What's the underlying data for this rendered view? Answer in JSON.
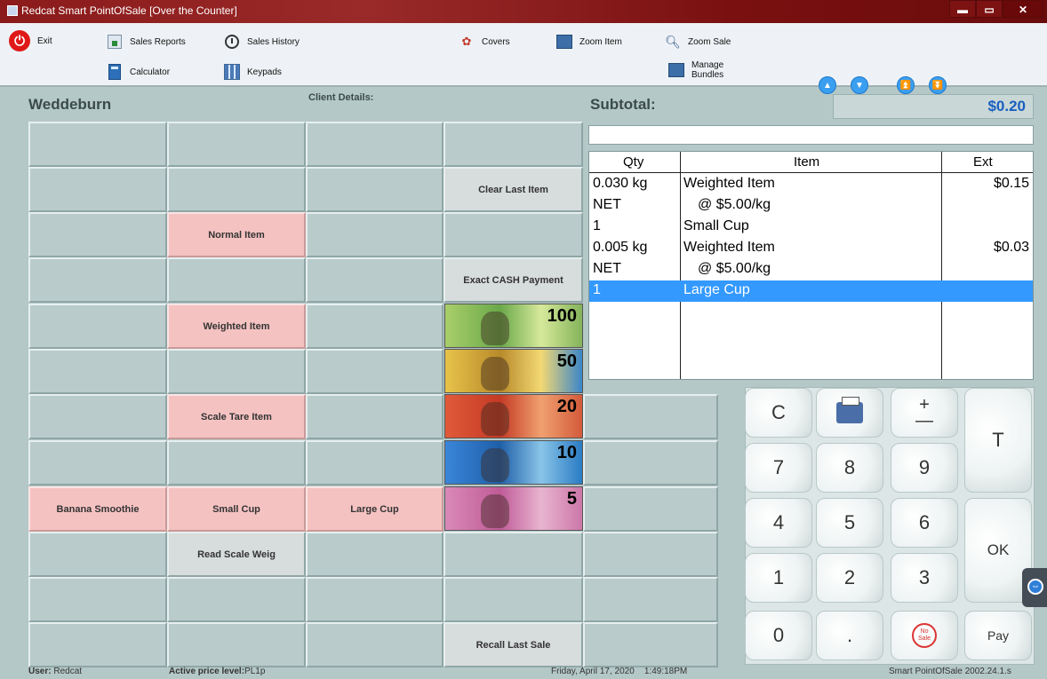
{
  "window": {
    "title": "Redcat Smart PointOfSale [Over the Counter]",
    "min": "▬",
    "max": "▭",
    "close": "✕"
  },
  "toolbar": {
    "exit": "Exit",
    "sales_reports": "Sales Reports",
    "sales_history": "Sales History",
    "covers": "Covers",
    "zoom_item": "Zoom Item",
    "zoom_sale": "Zoom Sale",
    "calculator": "Calculator",
    "keypads": "Keypads",
    "manage_bundles": "Manage Bundles",
    "nav": [
      "▲",
      "▼",
      "⏫",
      "⏬"
    ]
  },
  "header": {
    "store_name": "Weddeburn",
    "client_details": "Client Details:",
    "subtotal_label": "Subtotal:",
    "subtotal_value": "$0.20"
  },
  "grid_buttons": {
    "clear_last_item": "Clear Last Item",
    "normal_item": "Normal Item",
    "exact_cash_payment": "Exact CASH Payment",
    "weighted_item": "Weighted Item",
    "scale_tare_item": "Scale Tare Item",
    "banana_smoothie": "Banana Smoothie",
    "small_cup": "Small Cup",
    "large_cup": "Large Cup",
    "read_scale_weig": "Read Scale Weig",
    "recall_last_sale": "Recall Last Sale"
  },
  "cash_notes": [
    "100",
    "50",
    "20",
    "10",
    "5"
  ],
  "receipt": {
    "headers": {
      "qty": "Qty",
      "item": "Item",
      "ext": "Ext"
    },
    "rows": [
      {
        "qty": "0.030 kg",
        "item": "Weighted Item",
        "ext": "$0.15"
      },
      {
        "qty": "NET",
        "item": "@ $5.00/kg",
        "ext": ""
      },
      {
        "qty": "1",
        "item": "Small Cup",
        "ext": ""
      },
      {
        "qty": "0.005 kg",
        "item": "Weighted Item",
        "ext": "$0.03"
      },
      {
        "qty": "NET",
        "item": "@ $5.00/kg",
        "ext": ""
      },
      {
        "qty": "1",
        "item": "Large Cup",
        "ext": ""
      }
    ]
  },
  "keypad": {
    "clear": "C",
    "plus": "+",
    "minus": "—",
    "t": "T",
    "k7": "7",
    "k8": "8",
    "k9": "9",
    "k4": "4",
    "k5": "5",
    "k6": "6",
    "ok": "OK",
    "k1": "1",
    "k2": "2",
    "k3": "3",
    "k0": "0",
    "dot": ".",
    "no_sale": "No Sale",
    "pay": "Pay"
  },
  "status": {
    "user_label": "User:",
    "user": "Redcat",
    "price_label": "Active price level:",
    "price_level": "PL1p",
    "datetime": "Friday, April 17, 2020    1:49:18PM",
    "version": "Smart PointOfSale 2002.24.1.s"
  }
}
